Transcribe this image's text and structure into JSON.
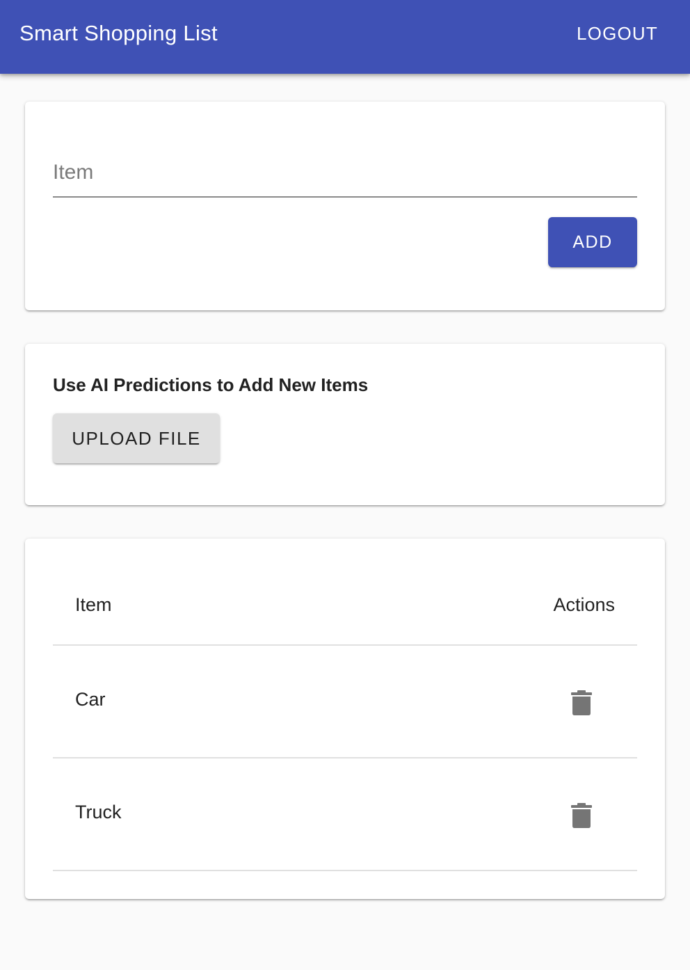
{
  "appbar": {
    "title": "Smart Shopping List",
    "logout_label": "LOGOUT",
    "color": "#3f51b5"
  },
  "add_form": {
    "item_placeholder": "Item",
    "item_value": "",
    "add_label": "ADD"
  },
  "ai_section": {
    "title": "Use AI Predictions to Add New Items",
    "upload_label": "UPLOAD FILE"
  },
  "table": {
    "headers": {
      "item": "Item",
      "actions": "Actions"
    },
    "rows": [
      {
        "item": "Car",
        "action_icon": "trash-icon"
      },
      {
        "item": "Truck",
        "action_icon": "trash-icon"
      }
    ]
  }
}
